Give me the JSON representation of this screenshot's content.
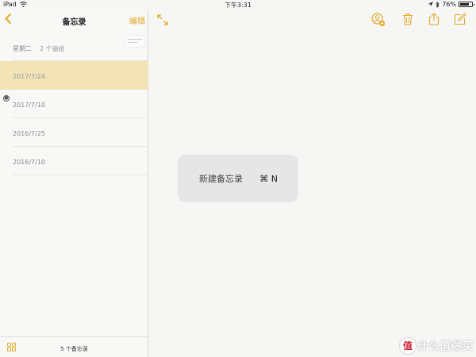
{
  "status_bar": {
    "device": "iPad",
    "time": "下午3:31",
    "battery_percent": "76%",
    "battery_level": 0.76
  },
  "sidebar": {
    "title": "备忘录",
    "edit_label": "编辑",
    "notes": [
      {
        "date": "星期二",
        "attachments": "2 个逾给",
        "selected": false,
        "has_thumbnail": true
      },
      {
        "date": "2017/7/24",
        "selected": true
      },
      {
        "date": "2017/7/10",
        "shared": true
      },
      {
        "date": "2016/7/25"
      },
      {
        "date": "2016/7/10"
      }
    ],
    "footer": {
      "count_label": "5 个备忘录"
    }
  },
  "shortcut_popup": {
    "label": "新建备忘录",
    "key": "⌘ N"
  },
  "watermark": {
    "text": "什么值得买",
    "badge": "值"
  },
  "colors": {
    "accent": "#e2a928",
    "selected_row": "#f2e4b7",
    "background": "#f6f6f4"
  },
  "icons": {
    "back": "chevron-left-icon",
    "expand": "expand-icon",
    "add_person": "add-person-icon",
    "trash": "trash-icon",
    "share": "share-icon",
    "compose": "compose-icon",
    "grid": "grid-icon"
  }
}
